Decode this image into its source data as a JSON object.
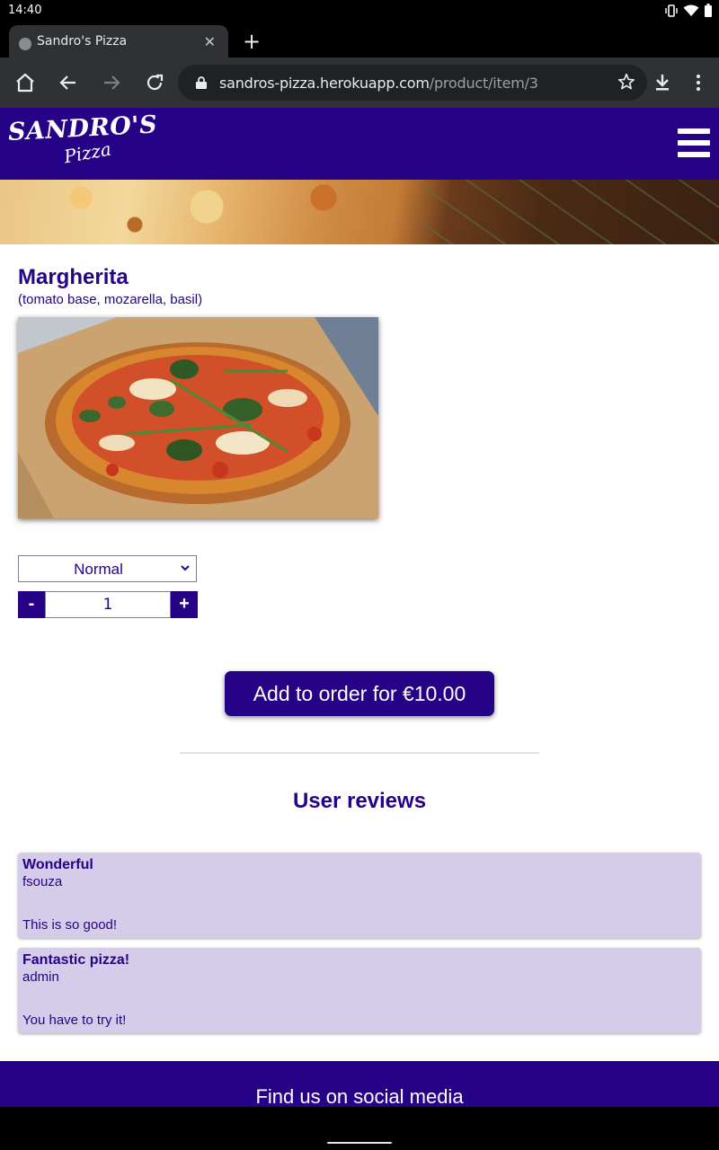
{
  "status_bar": {
    "time": "14:40",
    "icons": [
      "vibrate-icon",
      "wifi-icon",
      "battery-icon"
    ]
  },
  "browser": {
    "tab_title": "Sandro's Pizza",
    "url_host": "sandros-pizza.herokuapp.com",
    "url_path": "/product/item/3"
  },
  "site": {
    "logo_main": "SANDRO'S",
    "logo_sub": "Pizza"
  },
  "product": {
    "name": "Margherita",
    "description": "(tomato base, mozarella, basil)",
    "size_selected": "Normal",
    "quantity": "1",
    "minus_label": "-",
    "plus_label": "+",
    "add_button": "Add to order for €10.00"
  },
  "reviews": {
    "heading": "User reviews",
    "items": [
      {
        "title": "Wonderful",
        "user": "fsouza",
        "body": "This is so good!"
      },
      {
        "title": "Fantastic pizza!",
        "user": "admin",
        "body": "You have to try it!"
      }
    ]
  },
  "footer": {
    "text": "Find us on social media"
  },
  "colors": {
    "brand": "#250286",
    "review_bg": "#d4cce9"
  }
}
